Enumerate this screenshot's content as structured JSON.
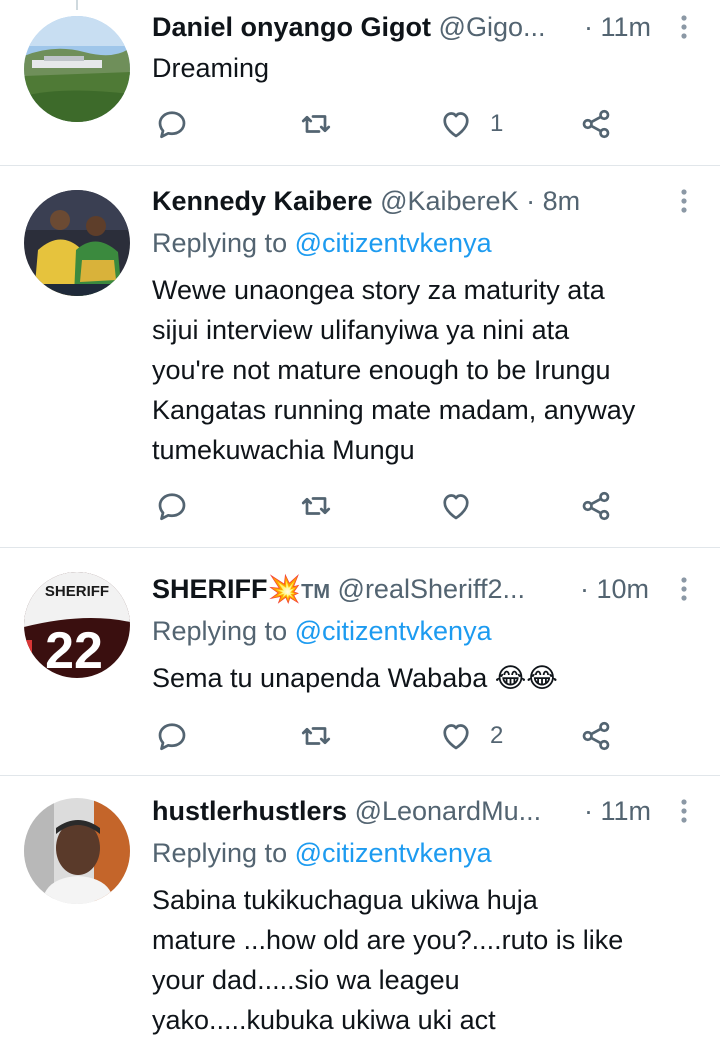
{
  "tweets": [
    {
      "name": "Daniel onyango Gigot",
      "handle": "@Gigo...",
      "separator": "·",
      "time": "11m",
      "replying_prefix": "",
      "replying_mention": "",
      "text": "Dreaming",
      "like_count": "1",
      "avatar": "landscape-photo"
    },
    {
      "name": "Kennedy Kaibere",
      "handle": "@KaibereK",
      "separator": "·",
      "time": "8m",
      "replying_prefix": "Replying to ",
      "replying_mention": "@citizentvkenya",
      "text": "Wewe unaongea story za maturity ata\nsijui interview ulifanyiwa ya nini ata\nyou're not mature enough to be Irungu\nKangatas running mate madam, anyway\ntumekuwachia Mungu",
      "like_count": "",
      "avatar": "couple-photo"
    },
    {
      "name": "SHERIFF💥",
      "name_suffix": "TM",
      "handle": "@realSheriff2...",
      "separator": "·",
      "time": "10m",
      "replying_prefix": "Replying to ",
      "replying_mention": "@citizentvkenya",
      "text": "Sema tu unapenda Wababa 😂😂",
      "like_count": "2",
      "avatar_text_top": "SHERIFF",
      "avatar_text_number": "22"
    },
    {
      "name": "hustlerhustlers",
      "handle": "@LeonardMu...",
      "separator": "·",
      "time": "11m",
      "replying_prefix": "Replying to ",
      "replying_mention": "@citizentvkenya",
      "text": "Sabina tukikuchagua ukiwa huja\nmature ...how old are you?....ruto is like\nyour dad.....sio wa leageu\nyako.....kubuka ukiwa uki act",
      "like_count": "",
      "avatar": "man-portrait-photo"
    }
  ],
  "icons": {
    "reply": "reply-icon",
    "retweet": "retweet-icon",
    "like": "heart-icon",
    "share": "share-icon",
    "more": "more-vertical-icon"
  },
  "colors": {
    "text": "#0f1419",
    "secondary": "#536471",
    "mention": "#1d9bf0",
    "divider": "#e1e6ea"
  }
}
